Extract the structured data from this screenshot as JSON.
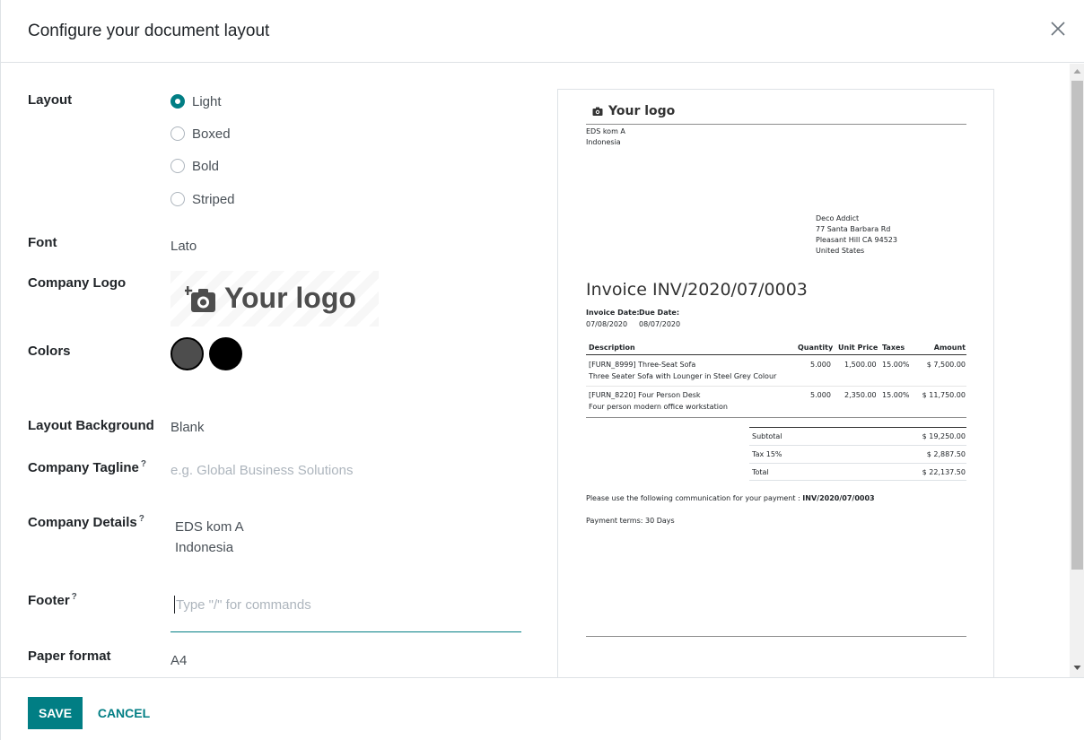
{
  "dialog": {
    "title": "Configure your document layout"
  },
  "form": {
    "layout": {
      "label": "Layout",
      "options": [
        "Light",
        "Boxed",
        "Bold",
        "Striped"
      ],
      "selected": "Light"
    },
    "font": {
      "label": "Font",
      "value": "Lato"
    },
    "logo": {
      "label": "Company Logo",
      "text": "Your logo"
    },
    "colors": {
      "label": "Colors",
      "primary": "#4d4d4d",
      "secondary": "#000000"
    },
    "background": {
      "label": "Layout Background",
      "value": "Blank"
    },
    "tagline": {
      "label": "Company Tagline",
      "help": "?",
      "placeholder": "e.g. Global Business Solutions"
    },
    "details": {
      "label": "Company Details",
      "help": "?",
      "line1": "EDS kom A",
      "line2": "Indonesia"
    },
    "footer": {
      "label": "Footer",
      "help": "?",
      "placeholder": "Type \"/\" for commands"
    },
    "paper": {
      "label": "Paper format",
      "value": "A4"
    }
  },
  "preview": {
    "logo_text": "Your logo",
    "company_line1": "EDS kom A",
    "company_line2": "Indonesia",
    "customer": [
      "Deco Addict",
      "77 Santa Barbara Rd",
      "Pleasant Hill CA 94523",
      "United States"
    ],
    "title": "Invoice INV/2020/07/0003",
    "invoice_date_label": "Invoice Date:",
    "invoice_date": "07/08/2020",
    "due_date_label": "Due Date:",
    "due_date": "08/07/2020",
    "columns": [
      "Description",
      "Quantity",
      "Unit Price",
      "Taxes",
      "Amount"
    ],
    "lines": [
      {
        "desc1": "[FURN_8999] Three-Seat Sofa",
        "desc2": "Three Seater Sofa with Lounger in Steel Grey Colour",
        "qty": "5.000",
        "price": "1,500.00",
        "tax": "15.00%",
        "amount": "$ 7,500.00"
      },
      {
        "desc1": "[FURN_8220] Four Person Desk",
        "desc2": "Four person modern office workstation",
        "qty": "5.000",
        "price": "2,350.00",
        "tax": "15.00%",
        "amount": "$ 11,750.00"
      }
    ],
    "subtotal_label": "Subtotal",
    "subtotal": "$ 19,250.00",
    "tax_label": "Tax 15%",
    "tax": "$ 2,887.50",
    "total_label": "Total",
    "total": "$ 22,137.50",
    "communication_text": "Please use the following communication for your payment : ",
    "communication_ref": "INV/2020/07/0003",
    "payment_terms": "Payment terms: 30 Days"
  },
  "footer_buttons": {
    "save": "SAVE",
    "cancel": "CANCEL"
  },
  "theme": {
    "primary": "#017e84"
  }
}
